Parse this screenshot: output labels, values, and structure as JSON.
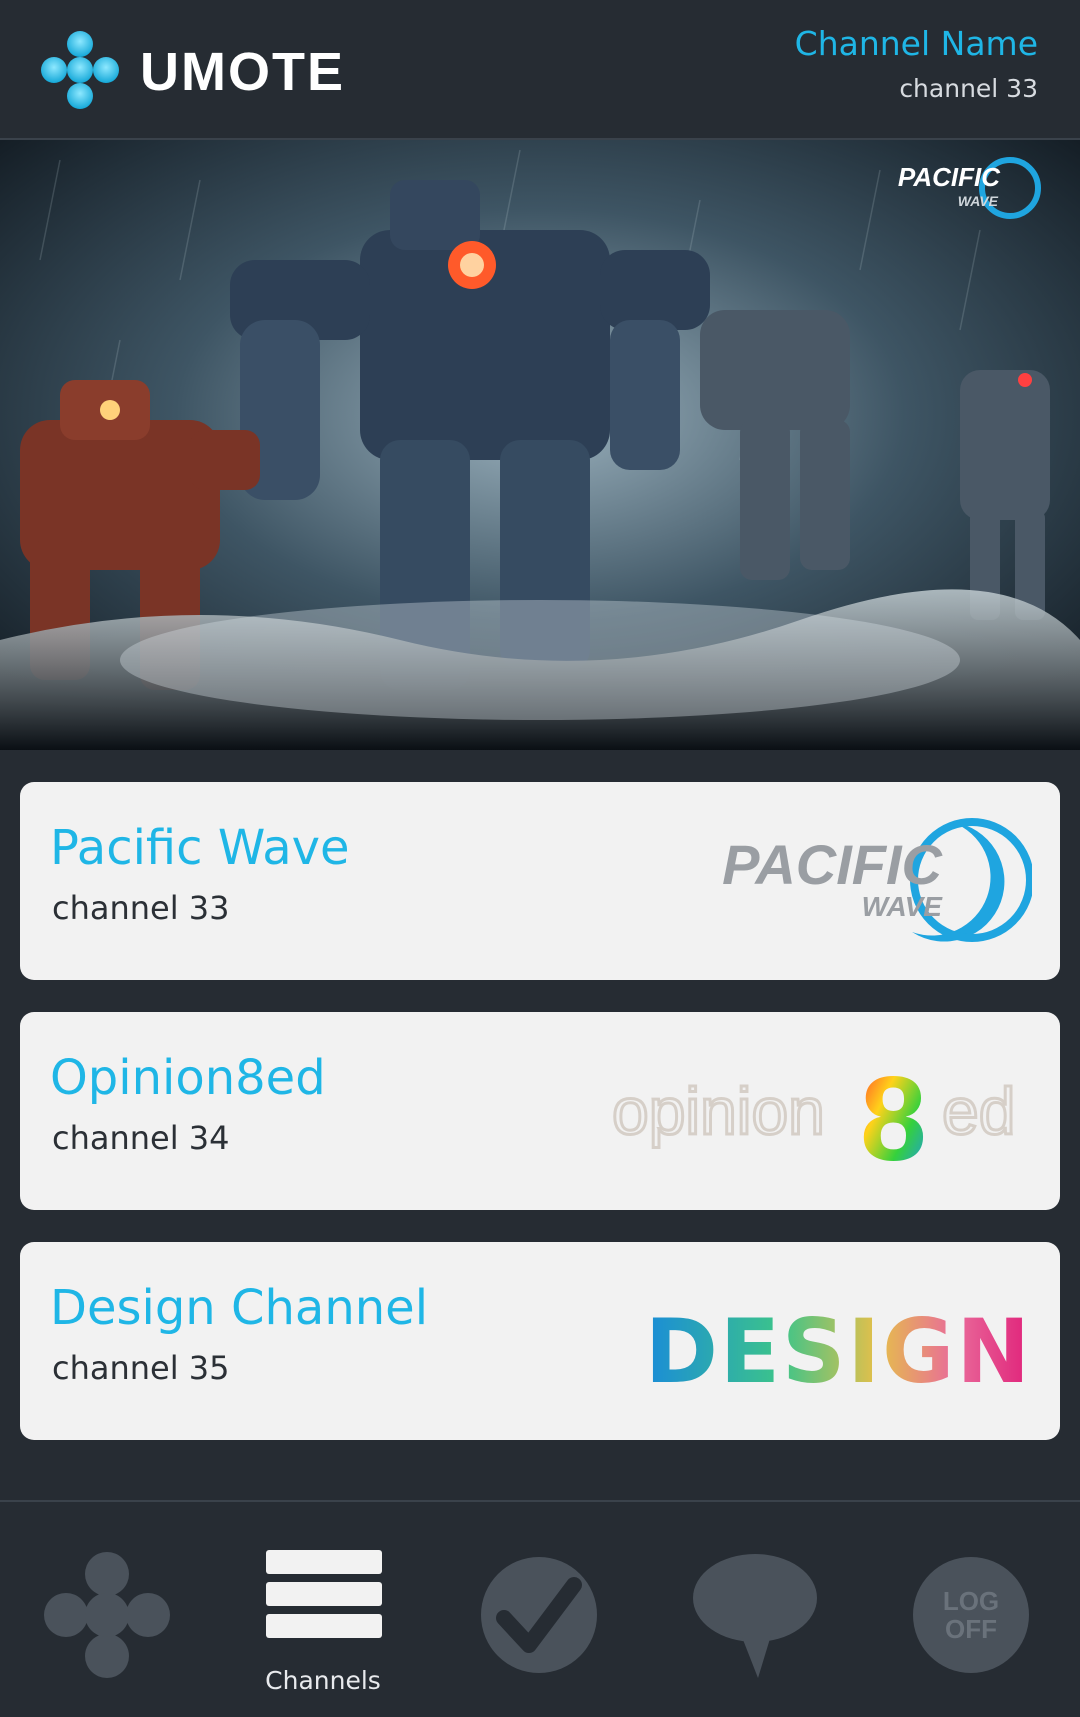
{
  "header": {
    "app_name": "UMOTE",
    "channel_title": "Channel Name",
    "channel_number": "channel 33"
  },
  "hero": {
    "logo_line1": "PACIFIC",
    "logo_line2": "WAVE"
  },
  "channels": [
    {
      "name": "Pacific Wave",
      "number": "channel 33",
      "logo_line1": "PACIFIC",
      "logo_line2": "WAVE"
    },
    {
      "name": "Opinion8ed",
      "number": "channel 34",
      "logo_text_a": "opinion",
      "logo_digit": "8",
      "logo_text_b": "ed"
    },
    {
      "name": "Design Channel",
      "number": "channel 35",
      "logo_text": "DESIGN"
    }
  ],
  "nav": {
    "channels_label": "Channels",
    "logoff_line1": "LOG",
    "logoff_line2": "OFF"
  },
  "colors": {
    "background": "#262c33",
    "accent": "#1fb6e6",
    "card": "#f2f2f2",
    "nav_icon": "#4a525b"
  },
  "icons": [
    "umote-logo-icon",
    "dpad-icon",
    "channels-list-icon",
    "checkmark-icon",
    "chat-bubble-icon",
    "log-off-icon"
  ]
}
